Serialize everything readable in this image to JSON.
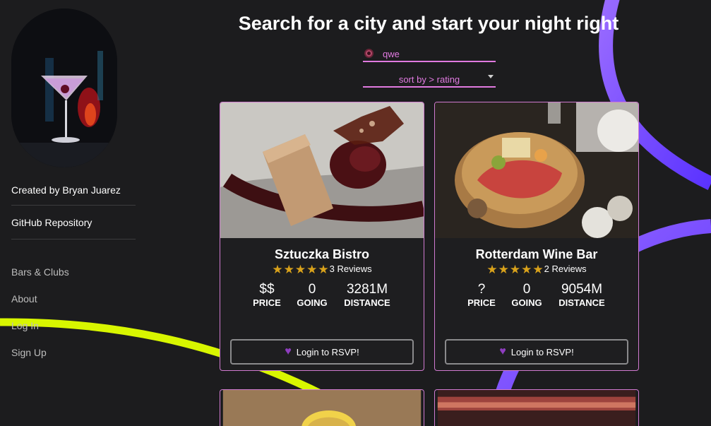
{
  "header": {
    "title": "Search for a city and start your night right"
  },
  "search": {
    "value": "qwe",
    "placeholder": ""
  },
  "sort": {
    "selected": "sort by > rating"
  },
  "sidebar": {
    "credit": "Created by Bryan Juarez",
    "repo": "GitHub Repository",
    "nav": [
      {
        "label": "Bars & Clubs"
      },
      {
        "label": "About"
      },
      {
        "label": "Log In"
      },
      {
        "label": "Sign Up"
      }
    ]
  },
  "cards": [
    {
      "name": "Sztuczka Bistro",
      "stars": 5,
      "reviews": "3 Reviews",
      "price": "$$",
      "price_label": "PRICE",
      "going": "0",
      "going_label": "GOING",
      "distance": "3281M",
      "distance_label": "DISTANCE",
      "rsvp": "Login to RSVP!"
    },
    {
      "name": "Rotterdam Wine Bar",
      "stars": 5,
      "reviews": "2 Reviews",
      "price": "?",
      "price_label": "PRICE",
      "going": "0",
      "going_label": "GOING",
      "distance": "9054M",
      "distance_label": "DISTANCE",
      "rsvp": "Login to RSVP!"
    }
  ],
  "icons": {
    "search": "location-pin-icon",
    "sort": "chevron-down-icon",
    "star": "star-icon",
    "rsvp": "heart-icon"
  },
  "colors": {
    "accent": "#e07ae0",
    "star": "#d9a21b",
    "heart": "#8e3dbf",
    "arc_yellow": "#d8f600",
    "arc_purple": "#7b3cff"
  }
}
